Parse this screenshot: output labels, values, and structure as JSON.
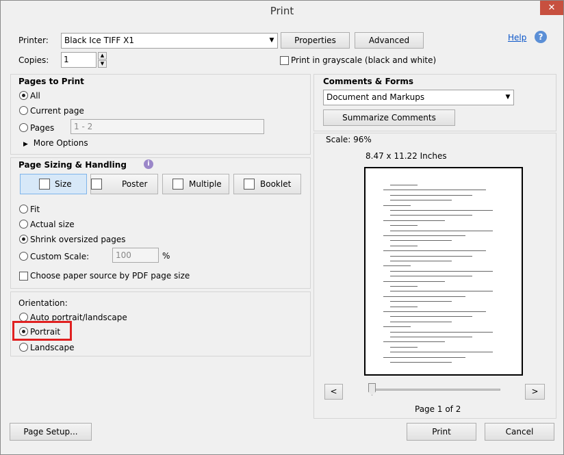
{
  "window": {
    "title": "Print"
  },
  "printer": {
    "label": "Printer:",
    "selected": "Black Ice TIFF X1",
    "properties_label": "Properties",
    "advanced_label": "Advanced",
    "help_label": "Help"
  },
  "copies": {
    "label": "Copies:",
    "value": "1"
  },
  "grayscale": {
    "label": "Print in grayscale (black and white)",
    "checked": false
  },
  "pages_to_print": {
    "heading": "Pages to Print",
    "options": [
      "All",
      "Current page",
      "Pages"
    ],
    "selected": "All",
    "pages_value": "1 - 2",
    "more_options_label": "More Options"
  },
  "page_sizing": {
    "heading": "Page Sizing & Handling",
    "tabs": [
      "Size",
      "Poster",
      "Multiple",
      "Booklet"
    ],
    "active_tab": "Size",
    "options": [
      "Fit",
      "Actual size",
      "Shrink oversized pages",
      "Custom Scale:"
    ],
    "selected": "Shrink oversized pages",
    "custom_scale_value": "100",
    "percent_label": "%",
    "paper_source_label": "Choose paper source by PDF page size",
    "paper_source_checked": false
  },
  "orientation": {
    "heading": "Orientation:",
    "options": [
      "Auto portrait/landscape",
      "Portrait",
      "Landscape"
    ],
    "selected": "Portrait"
  },
  "comments_forms": {
    "heading": "Comments & Forms",
    "selected": "Document and Markups",
    "summarize_label": "Summarize Comments"
  },
  "preview": {
    "scale_label": "Scale:  96%",
    "size_label": "8.47 x 11.22 Inches",
    "prev_label": "<",
    "next_label": ">",
    "page_label": "Page 1 of 2"
  },
  "footer": {
    "page_setup_label": "Page Setup...",
    "print_label": "Print",
    "cancel_label": "Cancel"
  },
  "colors": {
    "highlight_box": "#e02020",
    "active_tab_bg": "#d7e8f8"
  }
}
